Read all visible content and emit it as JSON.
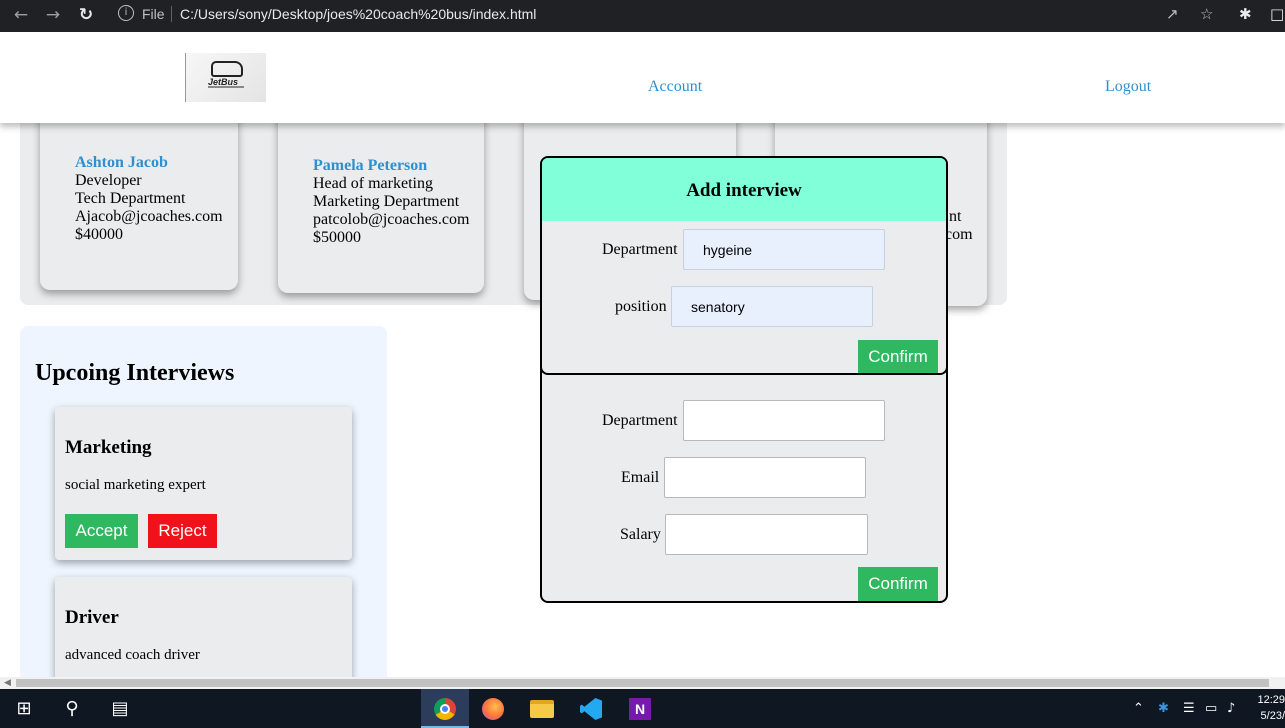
{
  "browser": {
    "scheme": "File",
    "url": "C:/Users/sony/Desktop/joes%20coach%20bus/index.html",
    "icons": [
      "back-icon",
      "forward-icon",
      "reload-icon",
      "info-icon",
      "share-icon",
      "star-icon",
      "extensions-icon",
      "sidebar-icon"
    ]
  },
  "header": {
    "logo_text": "JetBus",
    "nav": {
      "account": "Account",
      "logout": "Logout"
    }
  },
  "employees": [
    {
      "name": "Ashton Jacob",
      "role": "Developer",
      "department": "Tech Department",
      "email": "Ajacob@jcoaches.com",
      "salary": "$40000"
    },
    {
      "name": "Pamela Peterson",
      "role": "Head of marketing",
      "department": "Marketing Department",
      "email": "patcolob@jcoaches.com",
      "salary": "$50000"
    },
    {
      "partial_1": "nt",
      "partial_2": "com"
    }
  ],
  "interviews": {
    "title": "Upcoing Interviews",
    "items": [
      {
        "department": "Marketing",
        "position": "social marketing expert",
        "accept": "Accept",
        "reject": "Reject"
      },
      {
        "department": "Driver",
        "position": "advanced coach driver"
      }
    ]
  },
  "add_employee_modal": {
    "labels": {
      "department": "Department",
      "email": "Email",
      "salary": "Salary"
    },
    "values": {
      "department": "",
      "email": "",
      "salary": ""
    },
    "confirm": "Confirm"
  },
  "add_interview_modal": {
    "title": "Add interview",
    "labels": {
      "department": "Department",
      "position": "position"
    },
    "values": {
      "department": "hygeine",
      "position": "senatory"
    },
    "confirm": "Confirm"
  },
  "taskbar": {
    "apps": [
      "windows-start-icon",
      "search-icon",
      "task-view-icon",
      "chrome-icon",
      "firefox-icon",
      "file-explorer-icon",
      "vscode-icon",
      "onenote-icon"
    ],
    "clock_time": "12:29",
    "clock_date": "5/23/"
  },
  "colors": {
    "link": "#2e8fd1",
    "modal_header": "#81ffd9",
    "confirm": "#2fb85f",
    "reject": "#f0111a",
    "panel": "#ebeced",
    "interviews_panel": "#eef5ff"
  }
}
